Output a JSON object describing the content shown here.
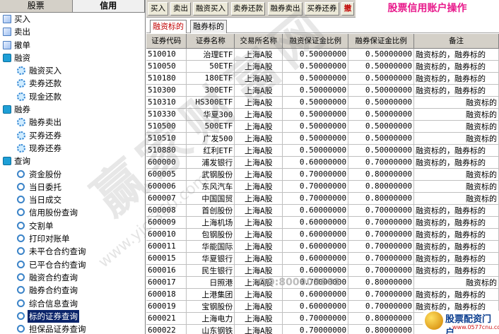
{
  "left_tabs": [
    "股票",
    "信用"
  ],
  "tree": [
    {
      "label": "买入",
      "level": 0,
      "icon": "leaf"
    },
    {
      "label": "卖出",
      "level": 0,
      "icon": "leaf"
    },
    {
      "label": "撤单",
      "level": 0,
      "icon": "leaf"
    },
    {
      "label": "融资",
      "level": 0,
      "icon": "folder"
    },
    {
      "label": "融资买入",
      "level": 1,
      "icon": "gear"
    },
    {
      "label": "卖券还款",
      "level": 1,
      "icon": "gear"
    },
    {
      "label": "现金还款",
      "level": 1,
      "icon": "gear"
    },
    {
      "label": "融券",
      "level": 0,
      "icon": "folder"
    },
    {
      "label": "融券卖出",
      "level": 1,
      "icon": "gear"
    },
    {
      "label": "买券还券",
      "level": 1,
      "icon": "gear"
    },
    {
      "label": "现券还券",
      "level": 1,
      "icon": "gear"
    },
    {
      "label": "查询",
      "level": 0,
      "icon": "folder"
    },
    {
      "label": "资金股份",
      "level": 1,
      "icon": "query"
    },
    {
      "label": "当日委托",
      "level": 1,
      "icon": "query"
    },
    {
      "label": "当日成交",
      "level": 1,
      "icon": "query"
    },
    {
      "label": "信用股份查询",
      "level": 1,
      "icon": "query"
    },
    {
      "label": "交割单",
      "level": 1,
      "icon": "query"
    },
    {
      "label": "打印对账单",
      "level": 1,
      "icon": "query"
    },
    {
      "label": "未平仓合约查询",
      "level": 1,
      "icon": "query"
    },
    {
      "label": "已平仓合约查询",
      "level": 1,
      "icon": "query"
    },
    {
      "label": "融资合约查询",
      "level": 1,
      "icon": "query"
    },
    {
      "label": "融券合约查询",
      "level": 1,
      "icon": "query"
    },
    {
      "label": "综合信息查询",
      "level": 1,
      "icon": "query"
    },
    {
      "label": "标的证券查询",
      "level": 1,
      "icon": "query",
      "selected": true
    },
    {
      "label": "担保品证券查询",
      "level": 1,
      "icon": "query"
    }
  ],
  "toolbar": {
    "buttons": [
      "买入",
      "卖出",
      "融资买入",
      "卖券还款",
      "融券卖出",
      "买券还券",
      "撤"
    ],
    "title": "股票信用账户操作"
  },
  "subtabs": [
    "融资标的",
    "融券标的"
  ],
  "table": {
    "headers": [
      "证券代码",
      "证券名称",
      "交易所名称",
      "融资保证金比例",
      "融券保证金比例",
      "备注"
    ],
    "rows": [
      [
        "510010",
        "治理ETF",
        "上海A股",
        "0.50000000",
        "0.50000000",
        "融资标的，融券标的"
      ],
      [
        "510050",
        "50ETF",
        "上海A股",
        "0.50000000",
        "0.50000000",
        "融资标的，融券标的"
      ],
      [
        "510180",
        "180ETF",
        "上海A股",
        "0.50000000",
        "0.50000000",
        "融资标的，融券标的"
      ],
      [
        "510300",
        "300ETF",
        "上海A股",
        "0.50000000",
        "0.50000000",
        "融资标的，融券标的"
      ],
      [
        "510310",
        "HS300ETF",
        "上海A股",
        "0.50000000",
        "0.50000000",
        "融资标的"
      ],
      [
        "510330",
        "华夏300",
        "上海A股",
        "0.50000000",
        "0.50000000",
        "融资标的"
      ],
      [
        "510500",
        "500ETF",
        "上海A股",
        "0.50000000",
        "0.50000000",
        "融资标的"
      ],
      [
        "510510",
        "广发500",
        "上海A股",
        "0.50000000",
        "0.50000000",
        "融资标的"
      ],
      [
        "510880",
        "红利ETF",
        "上海A股",
        "0.50000000",
        "0.50000000",
        "融资标的，融券标的"
      ],
      [
        "600000",
        "浦发银行",
        "上海A股",
        "0.60000000",
        "0.70000000",
        "融资标的，融券标的"
      ],
      [
        "600005",
        "武钢股份",
        "上海A股",
        "0.70000000",
        "0.80000000",
        "融资标的"
      ],
      [
        "600006",
        "东风汽车",
        "上海A股",
        "0.70000000",
        "0.80000000",
        "融资标的"
      ],
      [
        "600007",
        "中国国贸",
        "上海A股",
        "0.70000000",
        "0.80000000",
        "融资标的"
      ],
      [
        "600008",
        "首创股份",
        "上海A股",
        "0.60000000",
        "0.70000000",
        "融资标的，融券标的"
      ],
      [
        "600009",
        "上海机场",
        "上海A股",
        "0.60000000",
        "0.70000000",
        "融资标的，融券标的"
      ],
      [
        "600010",
        "包钢股份",
        "上海A股",
        "0.60000000",
        "0.70000000",
        "融资标的，融券标的"
      ],
      [
        "600011",
        "华能国际",
        "上海A股",
        "0.60000000",
        "0.70000000",
        "融资标的，融券标的"
      ],
      [
        "600015",
        "华夏银行",
        "上海A股",
        "0.60000000",
        "0.70000000",
        "融资标的，融券标的"
      ],
      [
        "600016",
        "民生银行",
        "上海A股",
        "0.60000000",
        "0.70000000",
        "融资标的，融券标的"
      ],
      [
        "600017",
        "日照港",
        "上海A股",
        "0.70000000",
        "0.80000000",
        "融资标的"
      ],
      [
        "600018",
        "上港集团",
        "上海A股",
        "0.60000000",
        "0.70000000",
        "融资标的，融券标的"
      ],
      [
        "600019",
        "宝钢股份",
        "上海A股",
        "0.60000000",
        "0.70000000",
        "融资标的，融券标的"
      ],
      [
        "600021",
        "上海电力",
        "上海A股",
        "0.70000000",
        "0.80000000",
        "融资标的"
      ],
      [
        "600022",
        "山东钢铁",
        "上海A股",
        "0.70000000",
        "0.80000000",
        "融资标的"
      ]
    ]
  },
  "watermark": {
    "text": "赢家财富网",
    "url": "www.yjcf360.com",
    "qq": "QQ:800003601"
  },
  "logo": {
    "title": "股票配资门户",
    "url": "www.0577cnu.com"
  }
}
